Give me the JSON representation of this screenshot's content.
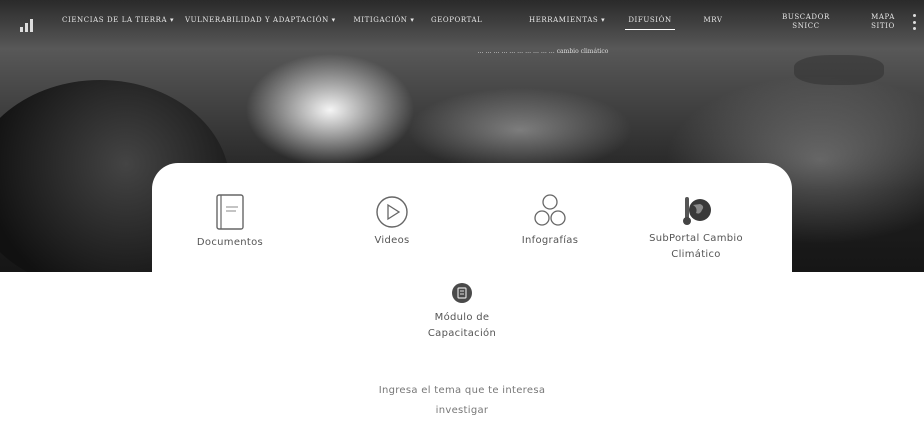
{
  "nav": {
    "items": [
      {
        "label": "CIENCIAS DE LA TIERRA ▾"
      },
      {
        "label": "VULNERABILIDAD Y ADAPTACIÓN ▾"
      },
      {
        "label": "MITIGACIÓN ▾"
      },
      {
        "label": "GEOPORTAL"
      },
      {
        "label": "HERRAMIENTAS ▾"
      },
      {
        "label": "DIFUSIÓN"
      },
      {
        "label": "MRV"
      },
      {
        "label": "BUSCADOR SNICC"
      },
      {
        "label": "MAPA SITIO"
      }
    ]
  },
  "hero": {
    "caption": "… … … … … … … … … … cambio climático"
  },
  "tiles": [
    {
      "label": "Documentos",
      "icon": "book-icon"
    },
    {
      "label": "Videos",
      "icon": "play-icon"
    },
    {
      "label": "Infografías",
      "icon": "circles-icon"
    },
    {
      "label": "SubPortal Cambio Climático",
      "icon": "thermometer-globe-icon"
    },
    {
      "label": "Módulo de Capacitación",
      "icon": "training-module-icon"
    }
  ],
  "search": {
    "prompt": "Ingresa el tema que te interesa investigar"
  }
}
